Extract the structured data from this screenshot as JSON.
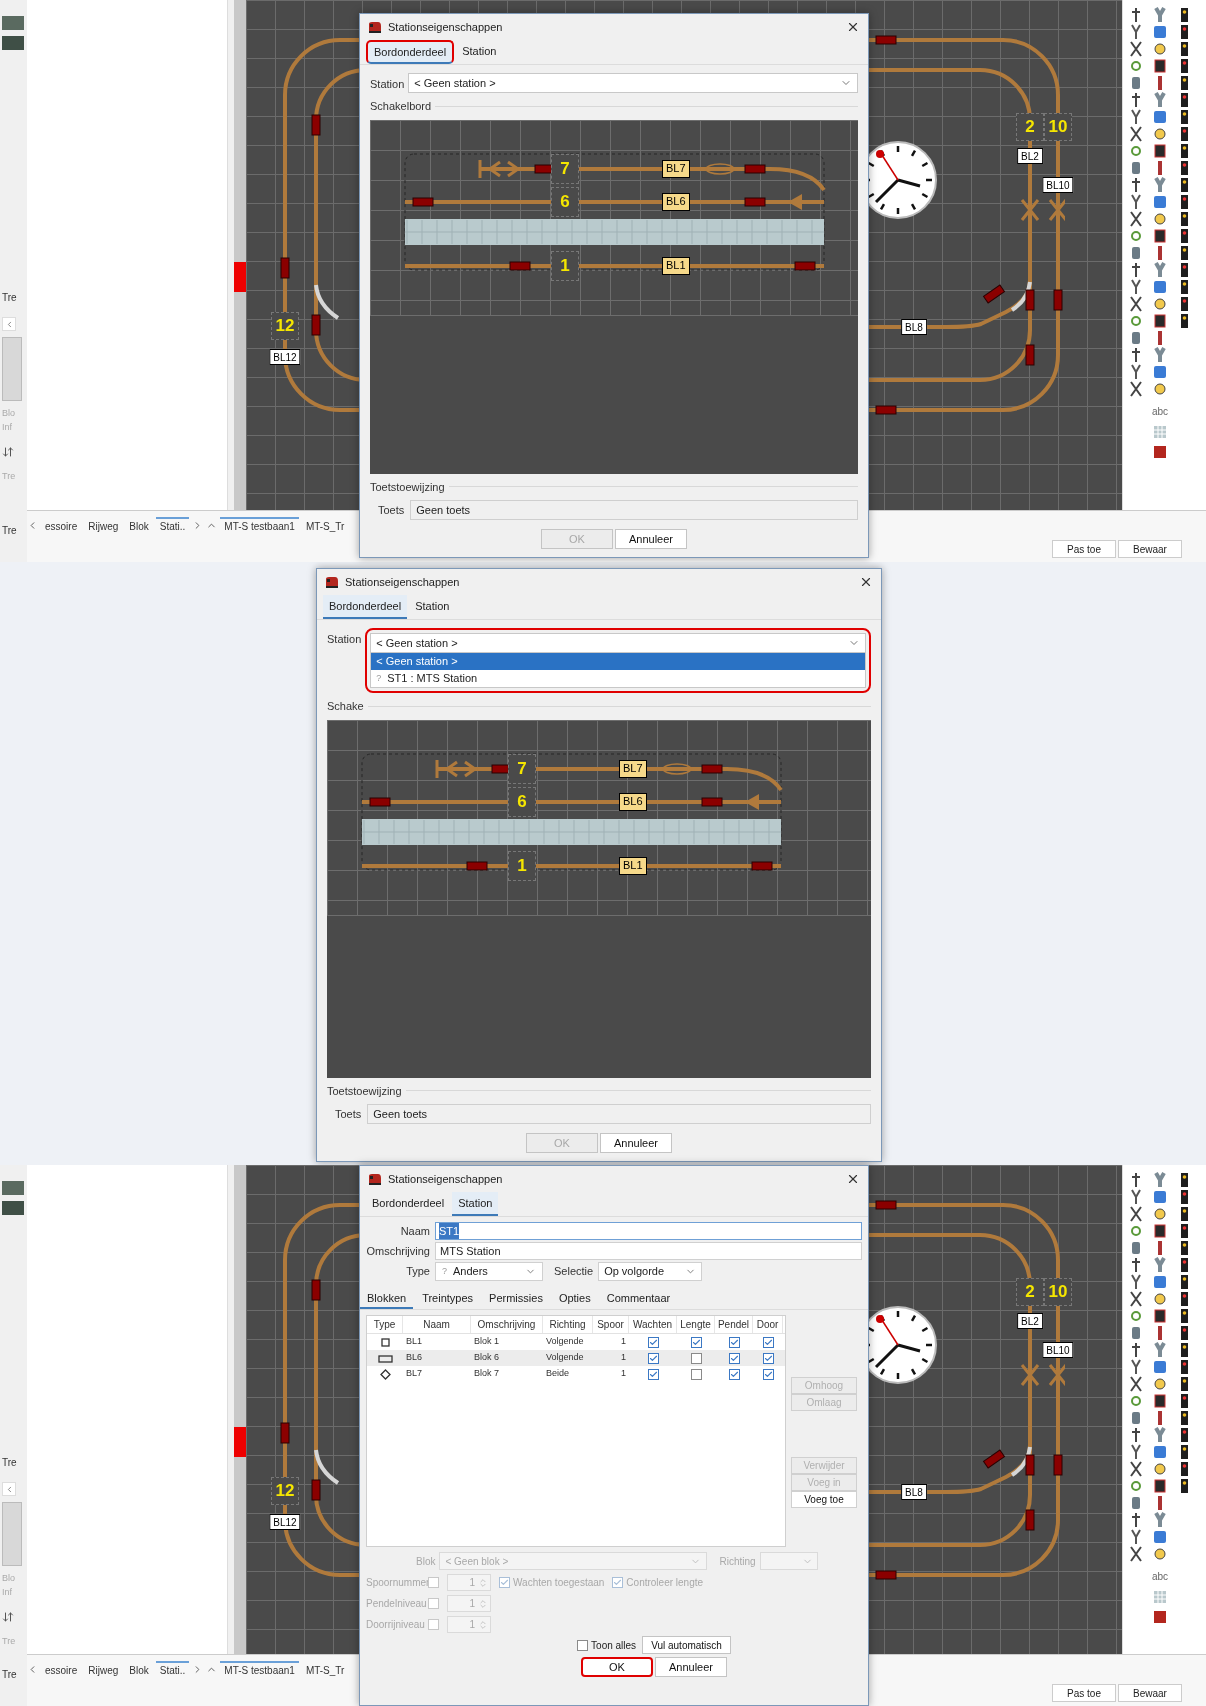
{
  "screenshots": [
    {
      "kind": "board_tab",
      "app": {
        "left_strip": [
          "Tre",
          "Blo",
          "Inf",
          "Tre",
          "Tre"
        ],
        "canvas_labels": [
          {
            "kind": "number",
            "text": "12"
          },
          {
            "kind": "block",
            "text": "BL12"
          },
          {
            "kind": "number",
            "text": "2"
          },
          {
            "kind": "number",
            "text": "10"
          },
          {
            "kind": "block",
            "text": "BL2"
          },
          {
            "kind": "block",
            "text": "BL10"
          },
          {
            "kind": "block",
            "text": "BL8"
          }
        ],
        "text_tool": "abc",
        "panel_tabs": [
          {
            "label": "essoire",
            "selected": false
          },
          {
            "label": "Rijweg",
            "selected": false
          },
          {
            "label": "Blok",
            "selected": false
          },
          {
            "label": "Stati..",
            "selected": true
          }
        ],
        "document_tabs": [
          {
            "label": "MT-S testbaan1",
            "selected": true
          },
          {
            "label": "MT-S_Tr",
            "selected": false
          }
        ],
        "buttons": [
          "Pas toe",
          "Bewaar"
        ]
      },
      "dialog": {
        "title": "Stationseigenschappen",
        "tabs": [
          {
            "label": "Bordonderdeel",
            "selected": true,
            "highlighted": true
          },
          {
            "label": "Station",
            "selected": false,
            "highlighted": false
          }
        ],
        "station_label": "Station",
        "station_value": "< Geen station >",
        "board_label": "Schakelbord",
        "board_tracks": [
          {
            "number": "7",
            "block": "BL7"
          },
          {
            "number": "6",
            "block": "BL6"
          },
          {
            "number": "1",
            "block": "BL1"
          }
        ],
        "key_group_label": "Toetstoewijzing",
        "key_label": "Toets",
        "key_value": "Geen toets",
        "buttons": [
          {
            "label": "OK",
            "disabled": true,
            "highlighted": false
          },
          {
            "label": "Annuleer",
            "disabled": false,
            "highlighted": false
          }
        ]
      }
    },
    {
      "kind": "dropdown",
      "dialog": {
        "title": "Stationseigenschappen",
        "tabs": [
          {
            "label": "Bordonderdeel",
            "selected": true,
            "highlighted": false
          },
          {
            "label": "Station",
            "selected": false,
            "highlighted": false
          }
        ],
        "station_label": "Station",
        "station_value": "< Geen station >",
        "dropdown": {
          "highlighted": true,
          "options": [
            {
              "label": "< Geen station >",
              "selected": true
            },
            {
              "icon": "?",
              "label": "ST1 : MTS Station",
              "selected": false
            }
          ]
        },
        "board_label": "Schake",
        "board_tracks": [
          {
            "number": "7",
            "block": "BL7"
          },
          {
            "number": "6",
            "block": "BL6"
          },
          {
            "number": "1",
            "block": "BL1"
          }
        ],
        "key_group_label": "Toetstoewijzing",
        "key_label": "Toets",
        "key_value": "Geen toets",
        "buttons": [
          {
            "label": "OK",
            "disabled": true,
            "highlighted": false
          },
          {
            "label": "Annuleer",
            "disabled": false,
            "highlighted": false
          }
        ]
      }
    },
    {
      "kind": "station_tab",
      "app": {
        "left_strip": [
          "Tre",
          "Blo",
          "Inf",
          "Tre",
          "Tre"
        ],
        "canvas_labels": [
          {
            "kind": "number",
            "text": "12"
          },
          {
            "kind": "block",
            "text": "BL12"
          },
          {
            "kind": "number",
            "text": "2"
          },
          {
            "kind": "number",
            "text": "10"
          },
          {
            "kind": "block",
            "text": "BL2"
          },
          {
            "kind": "block",
            "text": "BL10"
          },
          {
            "kind": "block",
            "text": "BL8"
          }
        ],
        "text_tool": "abc",
        "panel_tabs": [
          {
            "label": "essoire",
            "selected": false
          },
          {
            "label": "Rijweg",
            "selected": false
          },
          {
            "label": "Blok",
            "selected": false
          },
          {
            "label": "Stati..",
            "selected": true
          }
        ],
        "document_tabs": [
          {
            "label": "MT-S testbaan1",
            "selected": true
          },
          {
            "label": "MT-S_Tr",
            "selected": false
          }
        ],
        "buttons": [
          "Pas toe",
          "Bewaar"
        ]
      },
      "dialog": {
        "title": "Stationseigenschappen",
        "tabs": [
          {
            "label": "Bordonderdeel",
            "selected": false,
            "highlighted": false
          },
          {
            "label": "Station",
            "selected": true,
            "highlighted": false
          }
        ],
        "name_label": "Naam",
        "name_value": "ST1",
        "name_text_selected": true,
        "description_label": "Omschrijving",
        "description_value": "MTS Station",
        "type_label": "Type",
        "type_icon": "?",
        "type_value": "Anders",
        "selection_label": "Selectie",
        "selection_value": "Op volgorde",
        "subtabs": [
          {
            "label": "Blokken",
            "selected": true
          },
          {
            "label": "Treintypes",
            "selected": false
          },
          {
            "label": "Permissies",
            "selected": false
          },
          {
            "label": "Opties",
            "selected": false
          },
          {
            "label": "Commentaar",
            "selected": false
          }
        ],
        "table": {
          "columns": [
            "Type",
            "Naam",
            "Omschrijving",
            "Richting",
            "Spoor",
            "Wachten",
            "Lengte",
            "Pendel",
            "Door"
          ],
          "rows": [
            {
              "kind": "square",
              "name": "BL1",
              "description": "Blok 1",
              "direction": "Volgende",
              "track": "1",
              "wait": true,
              "length": true,
              "shuttle": true,
              "through": true,
              "selected": false
            },
            {
              "kind": "wide",
              "name": "BL6",
              "description": "Blok 6",
              "direction": "Volgende",
              "track": "1",
              "wait": true,
              "length": false,
              "shuttle": true,
              "through": true,
              "selected": true
            },
            {
              "kind": "diamond",
              "name": "BL7",
              "description": "Blok 7",
              "direction": "Beide",
              "track": "1",
              "wait": true,
              "length": false,
              "shuttle": true,
              "through": true,
              "selected": false
            }
          ]
        },
        "side_buttons": [
          {
            "label": "Omhoog",
            "disabled": true
          },
          {
            "label": "Omlaag",
            "disabled": true
          },
          {
            "label": "Verwijder",
            "disabled": true
          },
          {
            "label": "Voeg in",
            "disabled": true
          },
          {
            "label": "Voeg toe",
            "disabled": false
          }
        ],
        "form": {
          "disabled": true,
          "block_label": "Blok",
          "block_value": "< Geen blok >",
          "direction_label": "Richting",
          "levels": [
            {
              "label": "Spoornummer",
              "checked": false,
              "value": "1"
            },
            {
              "label": "Pendelniveau",
              "checked": false,
              "value": "1"
            },
            {
              "label": "Doorrijniveau",
              "checked": false,
              "value": "1"
            }
          ],
          "options": [
            {
              "label": "Wachten toegestaan",
              "checked": true
            },
            {
              "label": "Controleer lengte",
              "checked": true
            }
          ]
        },
        "show_all": {
          "label": "Toon alles",
          "checked": false
        },
        "fill_button": "Vul automatisch",
        "buttons": [
          {
            "label": "OK",
            "disabled": false,
            "highlighted": true
          },
          {
            "label": "Annuleer",
            "disabled": false,
            "highlighted": false
          }
        ]
      }
    }
  ]
}
